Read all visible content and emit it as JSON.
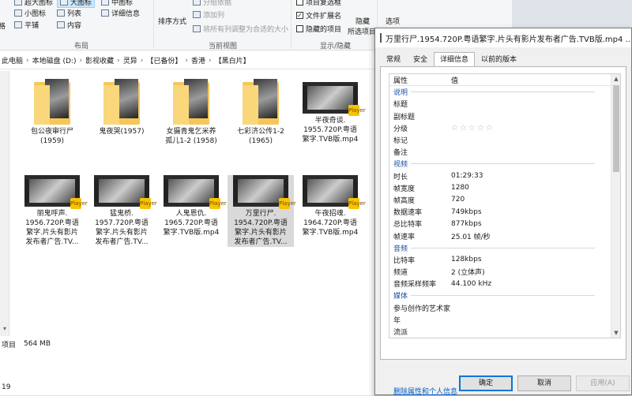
{
  "ribbon": {
    "layout_items": [
      "超大图标",
      "大图标",
      "中图标",
      "小图标",
      "列表",
      "详细信息",
      "平铺",
      "内容"
    ],
    "layout_label": "布局",
    "sort_label": "排序方式",
    "group_by": "分组依据",
    "add_column": "添加列",
    "fit_columns": "将所有列调整为合适的大小",
    "current_view_label": "当前视图",
    "item_checkboxes": "项目复选框",
    "file_extensions": "文件扩展名",
    "hidden_items": "隐藏的项目",
    "hide_selected_top": "隐藏",
    "hide_selected_bottom": "所选项目",
    "options": "选项",
    "show_hide_label": "显示/隐藏",
    "left_partial": "格"
  },
  "address": {
    "crumbs": [
      "此电脑",
      "本地磁盘 (D:)",
      "影视收藏",
      "灵异",
      "【已备份】",
      "香港",
      "【黑白片】"
    ]
  },
  "files": [
    {
      "kind": "folder",
      "name": "包公夜审行尸\n(1959)"
    },
    {
      "kind": "folder",
      "name": "鬼夜哭(1957)"
    },
    {
      "kind": "folder",
      "name": "女摄青鬼乞米养\n孤儿1-2 (1958)"
    },
    {
      "kind": "folder",
      "name": "七彩济公传1-2\n(1965)"
    },
    {
      "kind": "video",
      "name": "半夜奇谈.\n1955.720P.粤语\n繁字.TVB版.mp4"
    },
    {
      "kind": "video",
      "name": "丽鬼呼声.\n1956.720P.粤语\n繁字.片头有影片\n发布者广告.TV..."
    },
    {
      "kind": "video",
      "name": "猛鬼桥.\n1957.720P.粤语\n繁字.片头有影片\n发布者广告.TV..."
    },
    {
      "kind": "video",
      "name": "人鬼恩仇.\n1965.720P.粤语\n繁字.TVB版.mp4"
    },
    {
      "kind": "video",
      "name": "万里行尸.\n1954.720P.粤语\n繁字.片头有影片\n发布者广告.TV...",
      "selected": true
    },
    {
      "kind": "video",
      "name": "午夜招魂.\n1964.720P.粤语\n繁字.TVB版.mp4"
    }
  ],
  "badge_text": "Player",
  "status": {
    "left": "项目",
    "size": "564 MB",
    "bottom": "19"
  },
  "dialog": {
    "title": "万里行尸.1954.720P.粤语繁字.片头有影片发布者广告.TVB版.mp4 ...",
    "tabs": [
      "常规",
      "安全",
      "详细信息",
      "以前的版本"
    ],
    "active_tab": 2,
    "header": {
      "k": "属性",
      "v": "值"
    },
    "rows": [
      {
        "type": "section",
        "k": "说明"
      },
      {
        "k": "标题",
        "v": ""
      },
      {
        "k": "副标题",
        "v": ""
      },
      {
        "k": "分级",
        "v": "☆☆☆☆☆",
        "stars": true
      },
      {
        "k": "标记",
        "v": ""
      },
      {
        "k": "备注",
        "v": ""
      },
      {
        "type": "section",
        "k": "视频"
      },
      {
        "k": "时长",
        "v": "01:29:33"
      },
      {
        "k": "帧宽度",
        "v": "1280"
      },
      {
        "k": "帧高度",
        "v": "720"
      },
      {
        "k": "数据速率",
        "v": "749kbps"
      },
      {
        "k": "总比特率",
        "v": "877kbps"
      },
      {
        "k": "帧速率",
        "v": "25.01 帧/秒"
      },
      {
        "type": "section",
        "k": "音频"
      },
      {
        "k": "比特率",
        "v": "128kbps"
      },
      {
        "k": "频道",
        "v": "2 (立体声)"
      },
      {
        "k": "音频采样频率",
        "v": "44.100 kHz"
      },
      {
        "type": "section",
        "k": "媒体"
      },
      {
        "k": "参与创作的艺术家",
        "v": ""
      },
      {
        "k": "年",
        "v": ""
      },
      {
        "k": "流派",
        "v": ""
      }
    ],
    "remove_link": "删除属性和个人信息",
    "ok": "确定",
    "cancel": "取消",
    "apply": "应用(A)"
  }
}
